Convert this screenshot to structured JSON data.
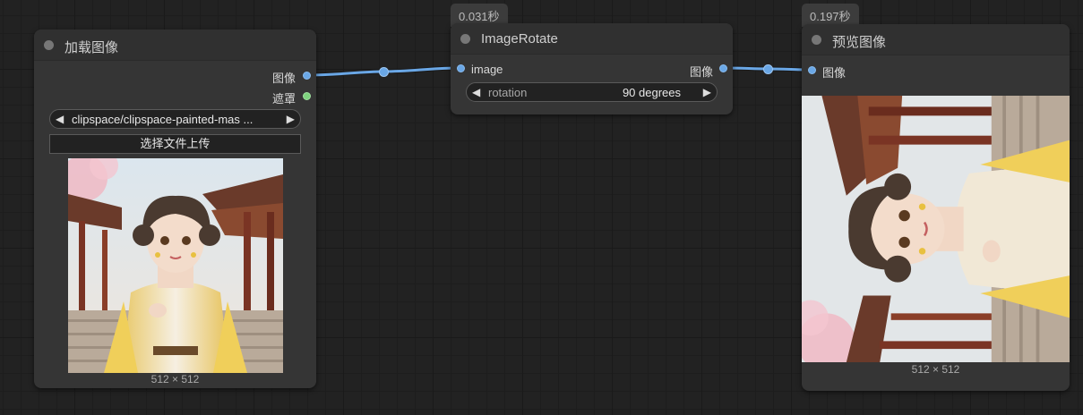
{
  "colors": {
    "canvas_bg": "#222222",
    "node_bg": "#353535",
    "image_socket": "#6aa7e6",
    "mask_socket": "#7fd37f",
    "wire": "#6aa7e6"
  },
  "load_node": {
    "title": "加载图像",
    "outputs": [
      {
        "label": "图像",
        "type": "IMAGE"
      },
      {
        "label": "遮罩",
        "type": "MASK"
      }
    ],
    "image_widget": {
      "value": "clipspace/clipspace-painted-mas ..."
    },
    "upload_label": "选择文件上传",
    "preview_caption": "512 × 512"
  },
  "rotate_node": {
    "badge": "0.031秒",
    "title": "ImageRotate",
    "input_label": "image",
    "output_label": "图像",
    "rotation_widget": {
      "name": "rotation",
      "value": "90 degrees"
    }
  },
  "preview_node": {
    "badge": "0.197秒",
    "title": "预览图像",
    "input_label": "图像",
    "preview_caption": "512 × 512"
  },
  "icons": {
    "combo_left": "◀",
    "combo_right": "▶"
  }
}
